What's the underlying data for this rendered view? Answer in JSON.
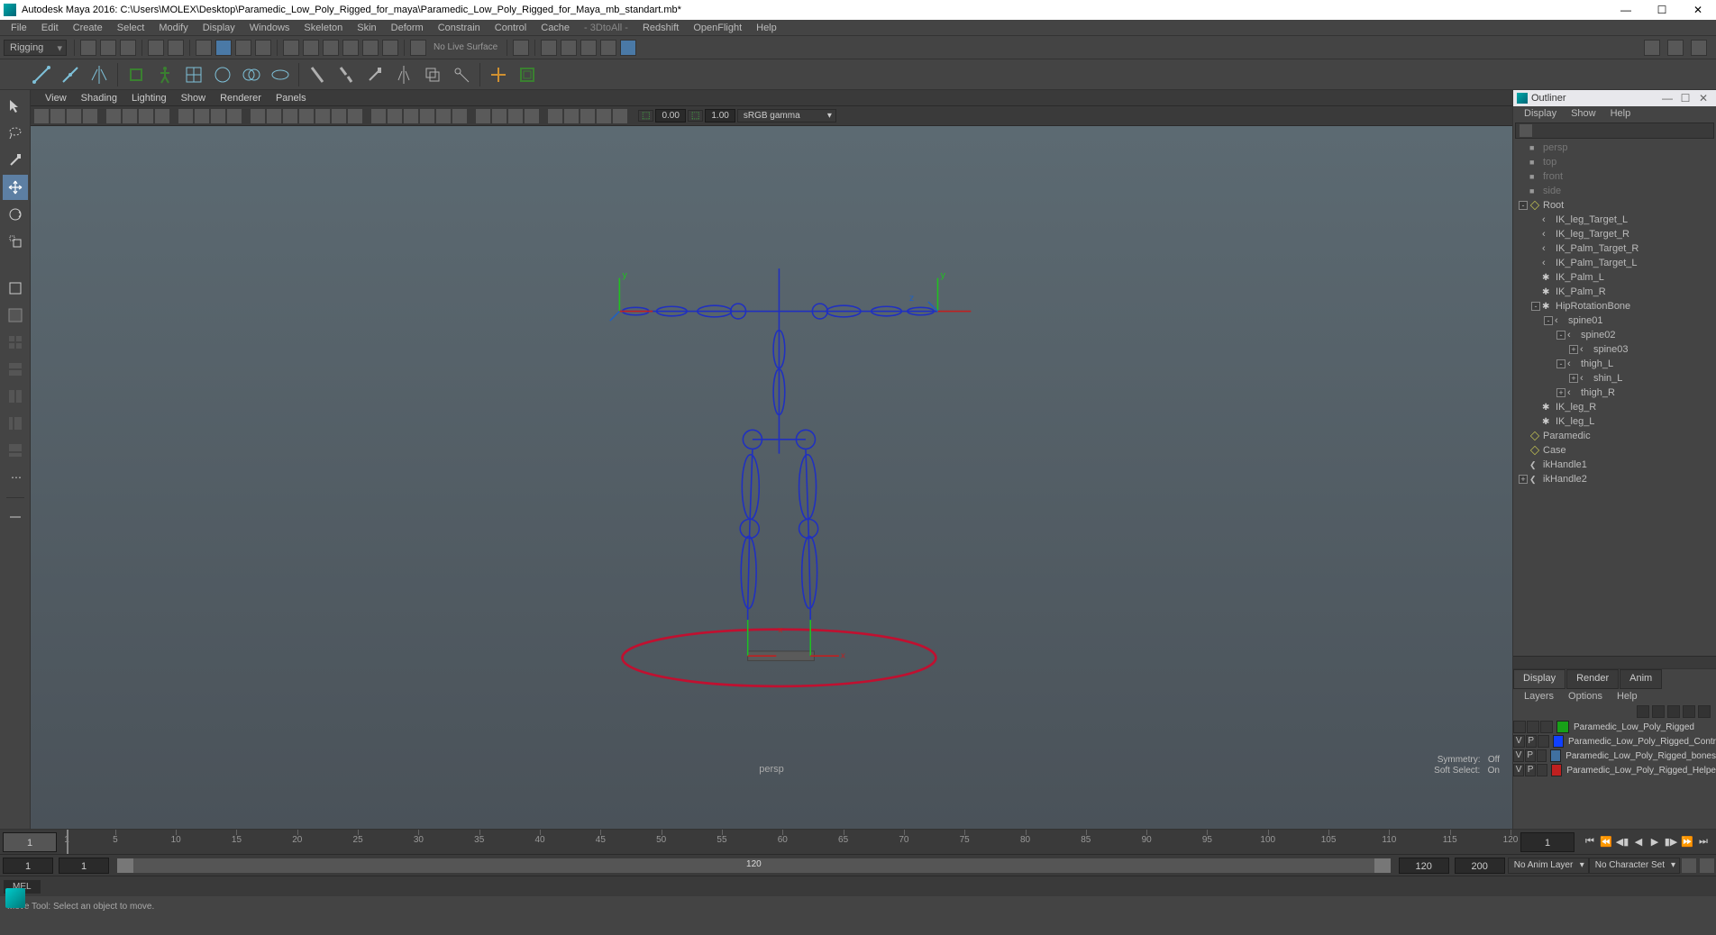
{
  "title": "Autodesk Maya 2016: C:\\Users\\MOLEX\\Desktop\\Paramedic_Low_Poly_Rigged_for_maya\\Paramedic_Low_Poly_Rigged_for_Maya_mb_standart.mb*",
  "menubar": [
    "File",
    "Edit",
    "Create",
    "Select",
    "Modify",
    "Display",
    "Windows",
    "Skeleton",
    "Skin",
    "Deform",
    "Constrain",
    "Control",
    "Cache"
  ],
  "menubar_plugins": [
    "- 3DtoAll -",
    "Redshift",
    "OpenFlight",
    "Help"
  ],
  "mode_dropdown": "Rigging",
  "no_live_surface": "No Live Surface",
  "viewport_menu": [
    "View",
    "Shading",
    "Lighting",
    "Show",
    "Renderer",
    "Panels"
  ],
  "gate_values": {
    "a": "0.00",
    "b": "1.00"
  },
  "colorspace": "sRGB gamma",
  "camera_label": "persp",
  "symmetry": {
    "label": "Symmetry:",
    "value": "Off"
  },
  "softselect": {
    "label": "Soft Select:",
    "value": "On"
  },
  "outliner": {
    "title": "Outliner",
    "menu": [
      "Display",
      "Show",
      "Help"
    ],
    "cameras": [
      "persp",
      "top",
      "front",
      "side"
    ],
    "tree": [
      {
        "name": "Root",
        "type": "locator",
        "children": [
          {
            "name": "IK_leg_Target_L",
            "type": "curve"
          },
          {
            "name": "IK_leg_Target_R",
            "type": "curve"
          },
          {
            "name": "IK_Palm_Target_R",
            "type": "curve"
          },
          {
            "name": "IK_Palm_Target_L",
            "type": "curve"
          },
          {
            "name": "IK_Palm_L",
            "type": "bone"
          },
          {
            "name": "IK_Palm_R",
            "type": "bone"
          },
          {
            "name": "HipRotationBone",
            "type": "bone",
            "children": [
              {
                "name": "spine01",
                "type": "curve",
                "children": [
                  {
                    "name": "spine02",
                    "type": "curve",
                    "children": [
                      {
                        "name": "spine03",
                        "type": "curve",
                        "collapsed": true
                      }
                    ]
                  },
                  {
                    "name": "thigh_L",
                    "type": "curve",
                    "children": [
                      {
                        "name": "shin_L",
                        "type": "curve",
                        "collapsed": true
                      }
                    ]
                  },
                  {
                    "name": "thigh_R",
                    "type": "curve",
                    "collapsed": true
                  }
                ]
              }
            ]
          },
          {
            "name": "IK_leg_R",
            "type": "bone"
          },
          {
            "name": "IK_leg_L",
            "type": "bone"
          }
        ]
      },
      {
        "name": "Paramedic",
        "type": "locator"
      },
      {
        "name": "Case",
        "type": "locator"
      },
      {
        "name": "ikHandle1",
        "type": "handle"
      },
      {
        "name": "ikHandle2",
        "type": "handle",
        "collapsed": true
      }
    ]
  },
  "layers_panel": {
    "tabs": [
      "Display",
      "Render",
      "Anim"
    ],
    "menu": [
      "Layers",
      "Options",
      "Help"
    ],
    "rows": [
      {
        "v": "",
        "p": "",
        "color": "#18a018",
        "name": "Paramedic_Low_Poly_Rigged"
      },
      {
        "v": "V",
        "p": "P",
        "color": "#1040ff",
        "name": "Paramedic_Low_Poly_Rigged_Contr"
      },
      {
        "v": "V",
        "p": "P",
        "color": "#4070a0",
        "name": "Paramedic_Low_Poly_Rigged_bones"
      },
      {
        "v": "V",
        "p": "P",
        "color": "#c02020",
        "name": "Paramedic_Low_Poly_Rigged_Helpe"
      }
    ]
  },
  "timeline": {
    "current": "1",
    "current2": "1",
    "ticks": [
      1,
      5,
      10,
      15,
      20,
      25,
      30,
      35,
      40,
      45,
      50,
      55,
      60,
      65,
      70,
      75,
      80,
      85,
      90,
      95,
      100,
      105,
      110,
      115,
      120
    ],
    "range_start": "1",
    "range_inner_start": "1",
    "range_inner_end": "120",
    "range_inner_end2": "120",
    "range_end": "200",
    "anim_layer": "No Anim Layer",
    "char_set": "No Character Set"
  },
  "cmd_lang": "MEL",
  "status_text": "Move Tool: Select an object to move."
}
